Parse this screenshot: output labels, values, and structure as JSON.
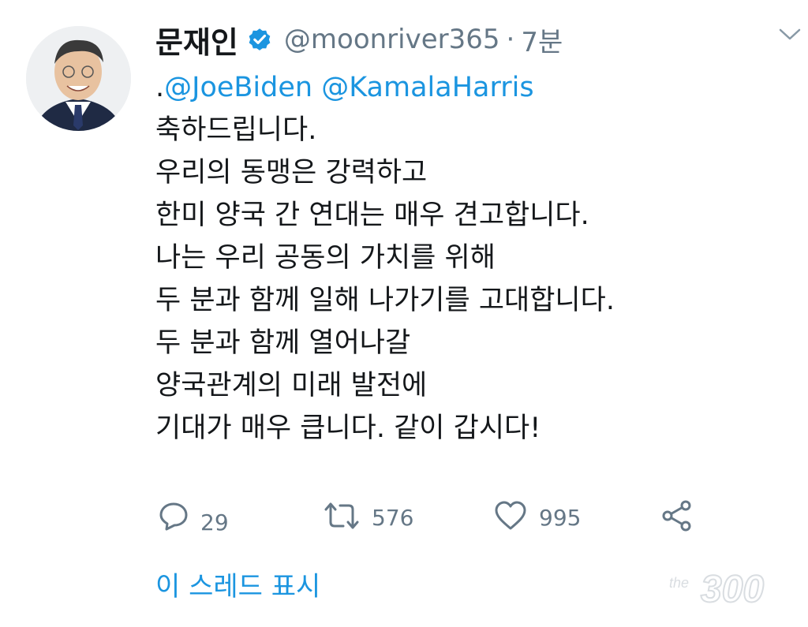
{
  "author": {
    "name": "문재인",
    "handle": "@moonriver365",
    "separator": "·",
    "time": "7분"
  },
  "tweet": {
    "mention_prefix": ".",
    "mention_1": "@JoeBiden",
    "mention_2": "@KamalaHarris",
    "lines": [
      "축하드립니다.",
      "우리의 동맹은 강력하고",
      "한미 양국 간 연대는 매우 견고합니다.",
      "나는 우리 공동의 가치를 위해",
      "두 분과 함께 일해 나가기를 고대합니다.",
      "두 분과 함께 열어나갈",
      "양국관계의 미래 발전에",
      "기대가 매우 큽니다. 같이 갑시다!"
    ]
  },
  "actions": {
    "replies": "29",
    "retweets": "576",
    "likes": "995"
  },
  "thread_link": "이 스레드 표시",
  "colors": {
    "link": "#1b95e0",
    "muted": "#657786",
    "text": "#14171a"
  },
  "icons": [
    "verified-badge-icon",
    "chevron-down-icon",
    "reply-icon",
    "retweet-icon",
    "like-icon",
    "share-icon"
  ]
}
